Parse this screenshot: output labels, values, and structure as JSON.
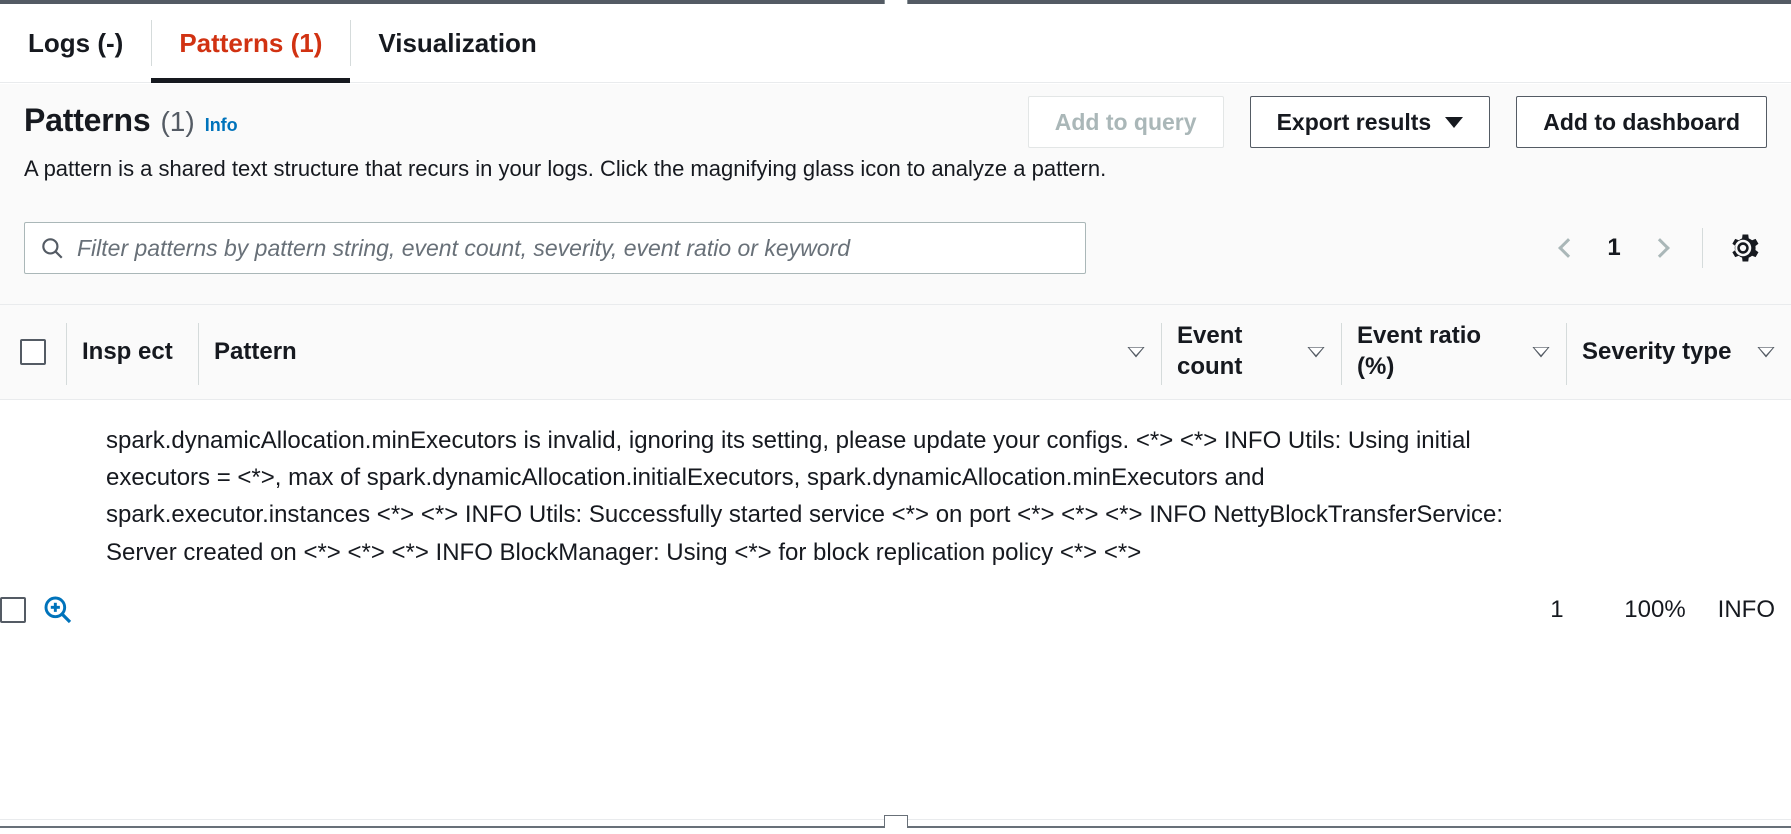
{
  "tabs": [
    {
      "label": "Logs (-)",
      "active": false
    },
    {
      "label": "Patterns (1)",
      "active": true
    },
    {
      "label": "Visualization",
      "active": false
    }
  ],
  "header": {
    "title": "Patterns",
    "count": "(1)",
    "info_label": "Info",
    "description": "A pattern is a shared text structure that recurs in your logs. Click the magnifying glass icon to analyze a pattern.",
    "buttons": {
      "add_to_query": "Add to query",
      "export_results": "Export results",
      "add_to_dashboard": "Add to dashboard"
    }
  },
  "filter": {
    "placeholder": "Filter patterns by pattern string, event count, severity, event ratio or keyword",
    "value": ""
  },
  "pagination": {
    "current_page": "1"
  },
  "table": {
    "columns": {
      "inspect": "Insp ect",
      "pattern": "Pattern",
      "event_count": "Event count",
      "event_ratio": "Event ratio (%)",
      "severity_type": "Severity type"
    },
    "rows": [
      {
        "pattern": "spark.dynamicAllocation.minExecutors is invalid, ignoring its setting, please update your configs. <*> <*> INFO Utils: Using initial executors = <*>, max of spark.dynamicAllocation.initialExecutors, spark.dynamicAllocation.minExecutors and spark.executor.instances <*> <*> INFO Utils: Successfully started service <*> on port <*> <*> <*> INFO NettyBlockTransferService: Server created on <*> <*> <*> INFO BlockManager: Using <*> for block replication policy <*> <*>",
        "event_count": "1",
        "event_ratio": "100%",
        "severity_type": "INFO"
      }
    ]
  },
  "colors": {
    "active_tab": "#d13212",
    "link": "#0073bb",
    "text": "#16191f",
    "muted": "#545b64",
    "panel_bg": "#fafafa",
    "border": "#e9ebed"
  }
}
